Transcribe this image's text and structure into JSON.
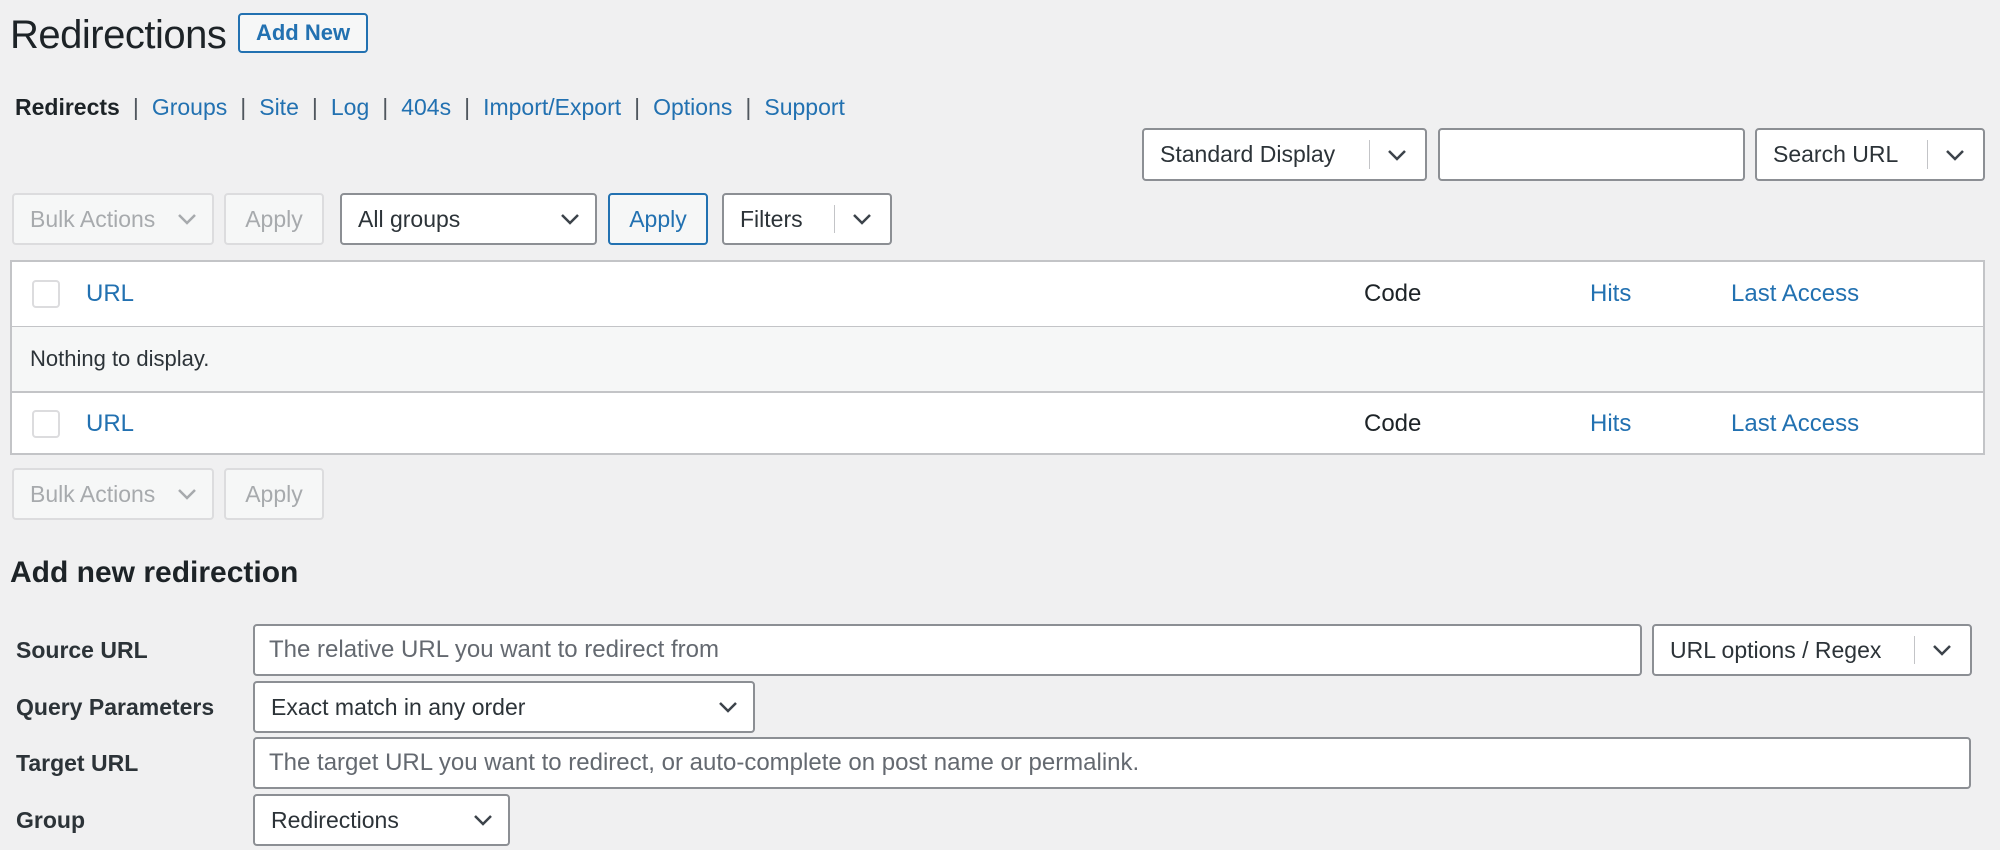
{
  "header": {
    "title": "Redirections",
    "add_new_label": "Add New"
  },
  "subnav": {
    "items": [
      {
        "label": "Redirects",
        "current": true
      },
      {
        "label": "Groups"
      },
      {
        "label": "Site"
      },
      {
        "label": "Log"
      },
      {
        "label": "404s"
      },
      {
        "label": "Import/Export"
      },
      {
        "label": "Options"
      },
      {
        "label": "Support"
      }
    ],
    "separator": "|"
  },
  "toolbar_top": {
    "display_mode": "Standard Display",
    "search_value": "",
    "search_type": "Search URL"
  },
  "bulk_top": {
    "bulk_actions": "Bulk Actions",
    "apply_label": "Apply",
    "group_filter": "All groups",
    "group_apply_label": "Apply",
    "filters_label": "Filters"
  },
  "table": {
    "columns": {
      "url": "URL",
      "code": "Code",
      "hits": "Hits",
      "last_access": "Last Access"
    },
    "empty_message": "Nothing to display."
  },
  "bulk_bottom": {
    "bulk_actions": "Bulk Actions",
    "apply_label": "Apply"
  },
  "add_new_form": {
    "title": "Add new redirection",
    "source_url_label": "Source URL",
    "source_url_placeholder": "The relative URL you want to redirect from",
    "url_options_label": "URL options / Regex",
    "query_params_label": "Query Parameters",
    "query_params_value": "Exact match in any order",
    "target_url_label": "Target URL",
    "target_url_placeholder": "The target URL you want to redirect, or auto-complete on post name or permalink.",
    "group_label": "Group",
    "group_value": "Redirections"
  },
  "colors": {
    "link": "#2271b1",
    "text": "#1d2327",
    "background": "#f0f0f1",
    "border": "#8c8f94",
    "disabled": "#a7aaad"
  }
}
